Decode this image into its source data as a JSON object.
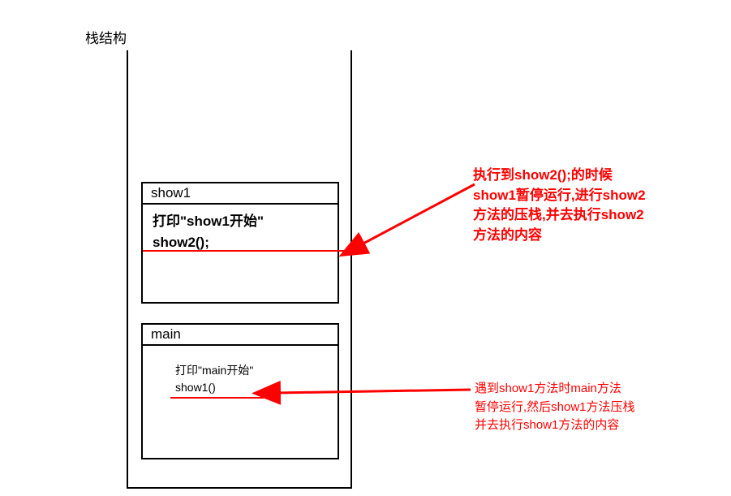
{
  "title": "栈结构",
  "stack": {
    "frames": [
      {
        "name": "show1",
        "lines": [
          "打印\"show1开始\"",
          "show2();"
        ]
      },
      {
        "name": "main",
        "lines": [
          "打印\"main开始\"",
          "show1()"
        ]
      }
    ]
  },
  "annotations": {
    "top": {
      "text_lines": [
        "执行到show2();的时候",
        "show1暂停运行,进行show2",
        "方法的压栈,并去执行show2",
        "方法的内容"
      ]
    },
    "bottom": {
      "text_lines": [
        "遇到show1方法时main方法",
        "暂停运行,然后show1方法压栈",
        "并去执行show1方法的内容"
      ]
    }
  },
  "colors": {
    "accent": "#ff0000",
    "border": "#000000"
  }
}
